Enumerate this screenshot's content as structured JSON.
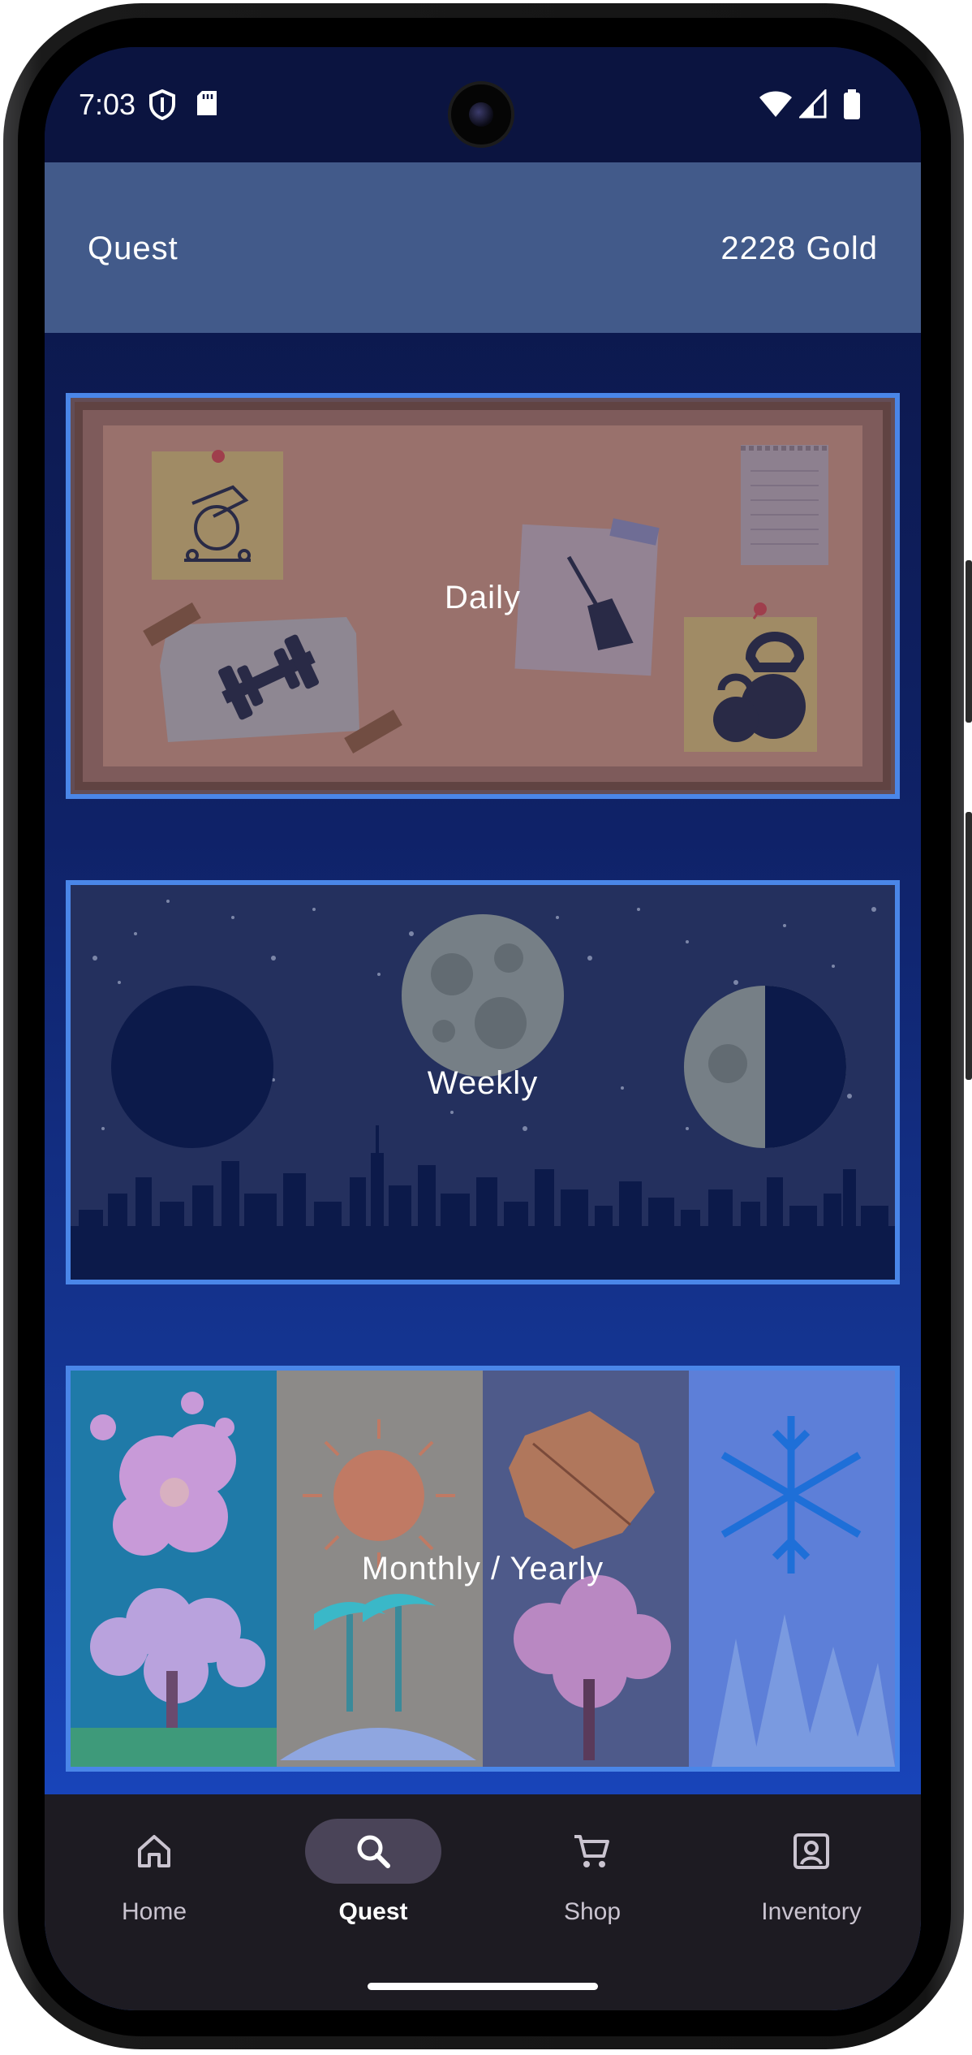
{
  "status_bar": {
    "time": "7:03",
    "icons": [
      "shield-icon",
      "sd-card-icon",
      "wifi-icon",
      "signal-icon",
      "battery-icon"
    ]
  },
  "app_bar": {
    "title": "Quest",
    "gold": "2228 Gold"
  },
  "quests": [
    {
      "label": "Daily",
      "theme": "corkboard"
    },
    {
      "label": "Weekly",
      "theme": "night-sky"
    },
    {
      "label": "Monthly / Yearly",
      "theme": "four-seasons"
    }
  ],
  "nav": {
    "items": [
      {
        "label": "Home",
        "icon": "home-icon"
      },
      {
        "label": "Quest",
        "icon": "search-icon",
        "active": true
      },
      {
        "label": "Shop",
        "icon": "cart-icon"
      },
      {
        "label": "Inventory",
        "icon": "profile-icon"
      }
    ]
  },
  "colors": {
    "accent_border": "#4a86e8",
    "app_bar": "#425a8a",
    "status_bar": "#0b1440",
    "nav_bar": "#1d1b22",
    "nav_active_pill": "#4a4458"
  }
}
